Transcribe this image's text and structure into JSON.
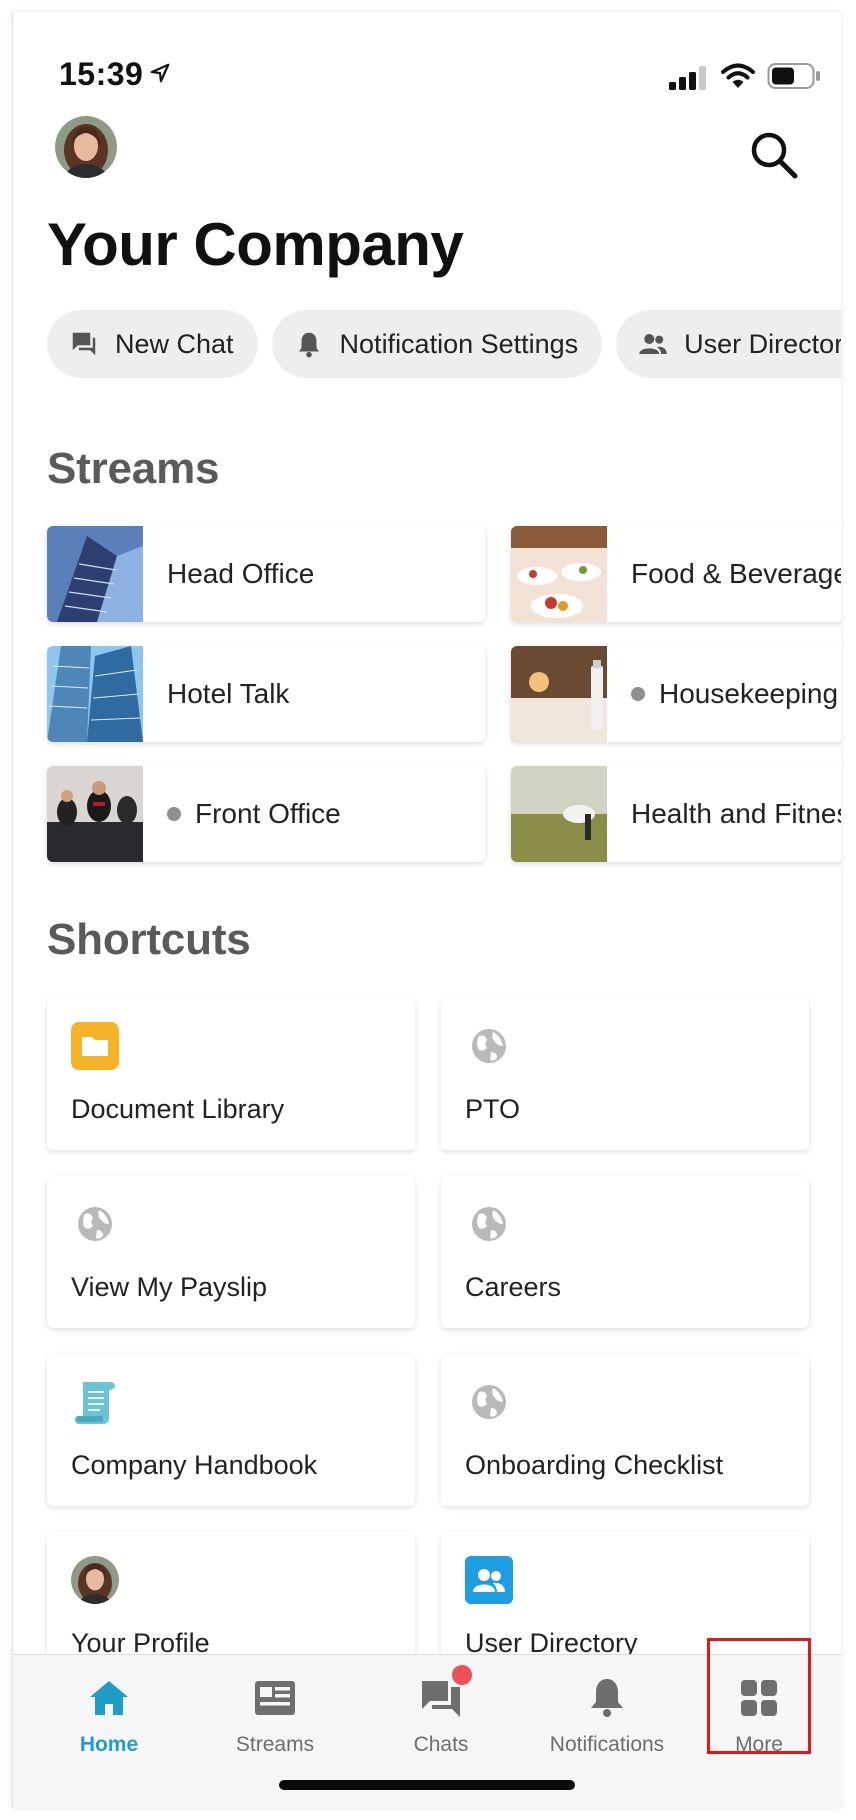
{
  "status_bar": {
    "time": "15:39"
  },
  "header": {
    "title": "Your Company"
  },
  "chips": [
    {
      "label": "New Chat",
      "icon": "chat-bubble-icon"
    },
    {
      "label": "Notification Settings",
      "icon": "bell-icon"
    },
    {
      "label": "User Directory",
      "icon": "people-icon"
    }
  ],
  "streams": {
    "title": "Streams",
    "items": [
      {
        "label": "Head Office",
        "unread": false
      },
      {
        "label": "Food & Beverage",
        "unread": false
      },
      {
        "label": "Hotel Talk",
        "unread": false
      },
      {
        "label": "Housekeeping",
        "unread": true
      },
      {
        "label": "Front Office",
        "unread": true
      },
      {
        "label": "Health and Fitness",
        "unread": false
      }
    ]
  },
  "shortcuts": {
    "title": "Shortcuts",
    "items": [
      {
        "label": "Document Library",
        "icon": "folder-icon"
      },
      {
        "label": "PTO",
        "icon": "globe-icon"
      },
      {
        "label": "View My Payslip",
        "icon": "globe-icon"
      },
      {
        "label": "Careers",
        "icon": "globe-icon"
      },
      {
        "label": "Company Handbook",
        "icon": "scroll-icon"
      },
      {
        "label": "Onboarding Checklist",
        "icon": "globe-icon"
      },
      {
        "label": "Your Profile",
        "icon": "avatar-icon"
      },
      {
        "label": "User Directory",
        "icon": "people-icon"
      }
    ]
  },
  "tabbar": {
    "items": [
      {
        "label": "Home",
        "icon": "home-icon",
        "active": true
      },
      {
        "label": "Streams",
        "icon": "streams-icon",
        "active": false
      },
      {
        "label": "Chats",
        "icon": "chats-icon",
        "active": false,
        "badge": true
      },
      {
        "label": "Notifications",
        "icon": "bell-icon",
        "active": false
      },
      {
        "label": "More",
        "icon": "grid-icon",
        "active": false,
        "highlighted": true
      }
    ]
  },
  "colors": {
    "accent": "#1e9ec4",
    "badge": "#f0505a",
    "highlight": "#e01919",
    "folder": "#f5b32a",
    "directory_blue": "#1e9ee0"
  }
}
